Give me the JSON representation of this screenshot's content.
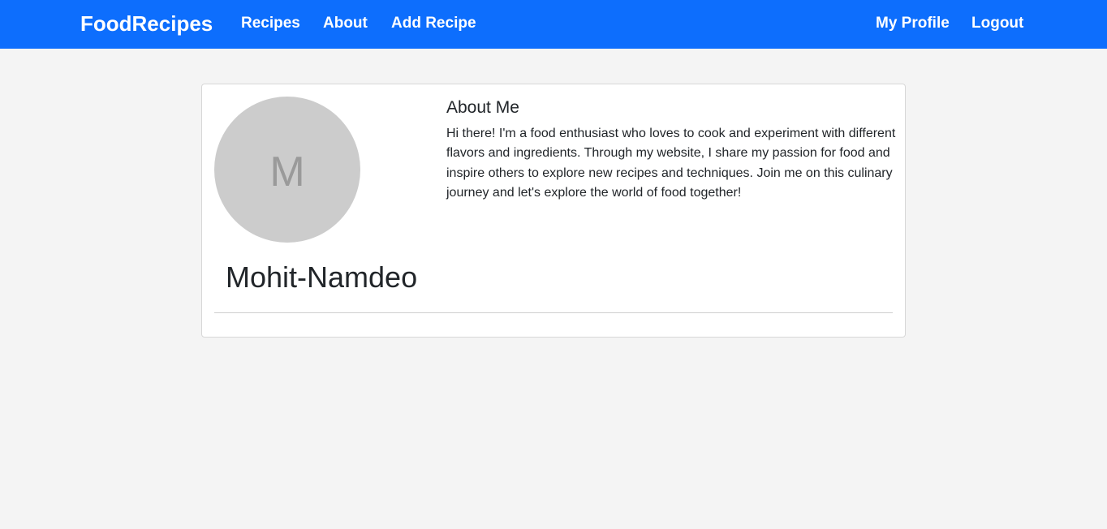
{
  "navbar": {
    "brand": "FoodRecipes",
    "links": [
      "Recipes",
      "About",
      "Add Recipe"
    ],
    "right_links": [
      "My Profile",
      "Logout"
    ],
    "color": "#0d6efd"
  },
  "profile": {
    "avatar_initial": "M",
    "username": "Mohit-Namdeo",
    "about_title": "About Me",
    "about_text": "Hi there! I'm a food enthusiast who loves to cook and experiment with different flavors and ingredients. Through my website, I share my passion for food and inspire others to explore new recipes and techniques. Join me on this culinary journey and let's explore the world of food together!"
  }
}
